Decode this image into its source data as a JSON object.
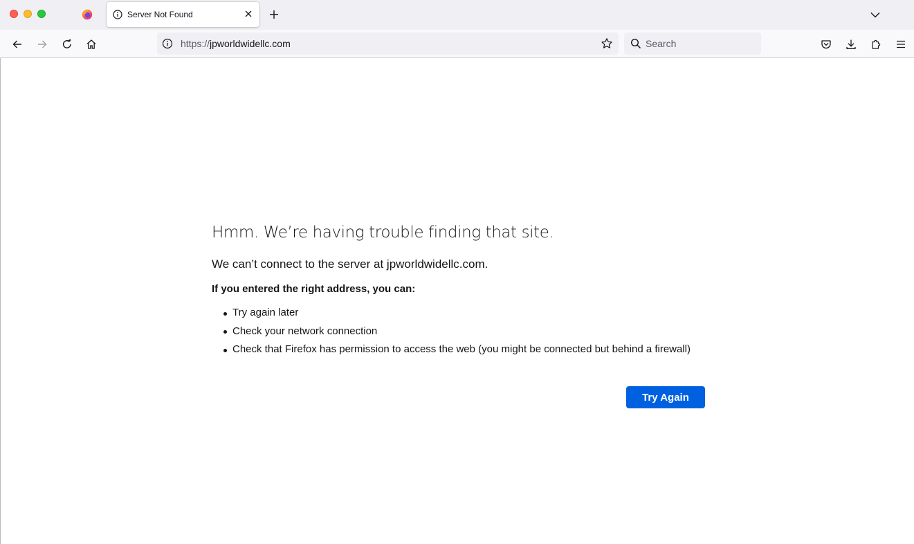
{
  "browser": {
    "tab": {
      "title": "Server Not Found"
    },
    "urlbar": {
      "scheme": "https://",
      "host": "jpworldwidellc.com"
    },
    "search": {
      "placeholder": "Search"
    }
  },
  "error_page": {
    "title": "Hmm. We’re having trouble finding that site.",
    "description": "We can’t connect to the server at jpworldwidellc.com.",
    "hint": "If you entered the right address, you can:",
    "suggestions": [
      "Try again later",
      "Check your network connection",
      "Check that Firefox has permission to access the web (you might be connected but behind a firewall)"
    ],
    "try_again_label": "Try Again"
  },
  "colors": {
    "accent_button": "#0061e0",
    "tabstrip_bg": "#f0f0f4",
    "toolbar_bg": "#f9f9fb"
  },
  "icons": [
    "firefox-icon",
    "info-icon",
    "close-icon",
    "plus-icon",
    "chevron-down-icon",
    "back-icon",
    "forward-icon",
    "reload-icon",
    "home-icon",
    "star-icon",
    "search-icon",
    "pocket-icon",
    "download-icon",
    "extensions-icon",
    "menu-icon"
  ]
}
